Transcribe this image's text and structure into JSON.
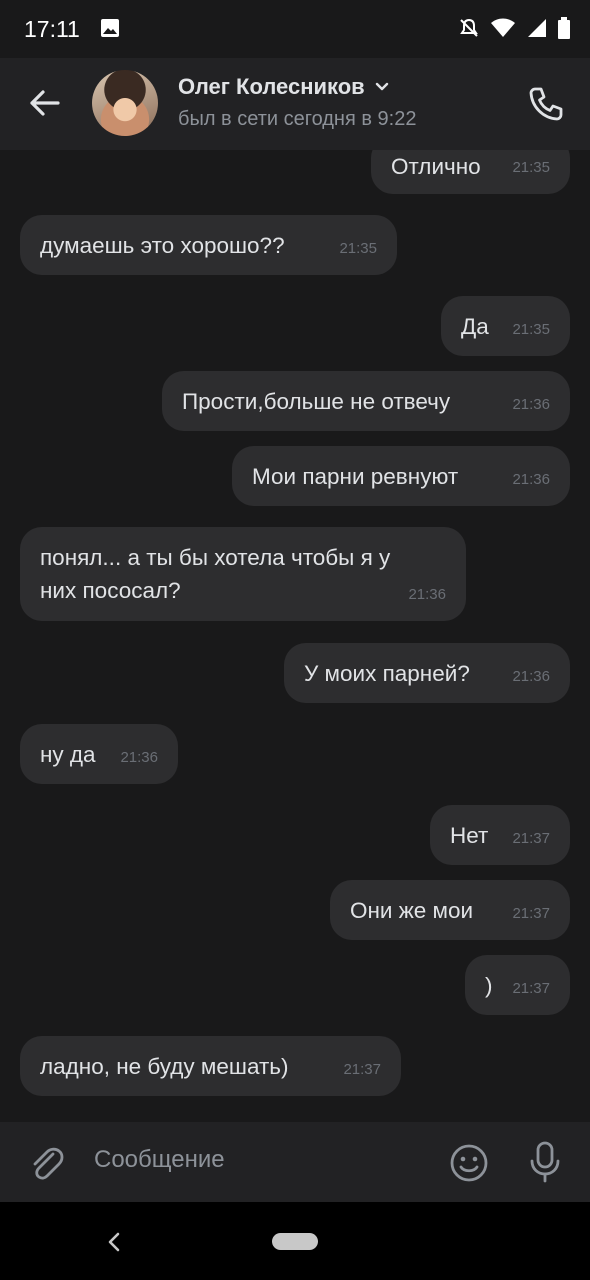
{
  "status_bar": {
    "time": "17:11"
  },
  "header": {
    "contact_name": "Олег Колесников",
    "last_seen": "был в сети сегодня в 9:22"
  },
  "messages": [
    {
      "from": "me",
      "text": "Отлично",
      "time": "21:35"
    },
    {
      "from": "them",
      "text": "думаешь это хорошо??",
      "time": "21:35"
    },
    {
      "from": "me",
      "text": "Да",
      "time": "21:35"
    },
    {
      "from": "me",
      "text": "Прости,больше не отвечу",
      "time": "21:36"
    },
    {
      "from": "me",
      "text": "Мои парни ревнуют",
      "time": "21:36"
    },
    {
      "from": "them",
      "text_line1": "понял... а ты бы хотела чтобы я у",
      "text_line2": "них пососал?",
      "time": "21:36"
    },
    {
      "from": "me",
      "text": "У моих парней?",
      "time": "21:36"
    },
    {
      "from": "them",
      "text": "ну да",
      "time": "21:36"
    },
    {
      "from": "me",
      "text": "Нет",
      "time": "21:37"
    },
    {
      "from": "me",
      "text": "Они же мои",
      "time": "21:37"
    },
    {
      "from": "me",
      "text": ")",
      "time": "21:37"
    },
    {
      "from": "them",
      "text": "ладно, не буду мешать)",
      "time": "21:37"
    }
  ],
  "composer": {
    "placeholder": "Сообщение"
  },
  "icons": {
    "back": "arrow-left-icon",
    "call": "phone-icon",
    "attach": "paperclip-icon",
    "emoji": "smiley-icon",
    "mic": "microphone-icon"
  },
  "colors": {
    "background": "#19191a",
    "bubble": "#2d2d2f",
    "text": "#e1e3e6",
    "secondary": "#8d9299"
  }
}
